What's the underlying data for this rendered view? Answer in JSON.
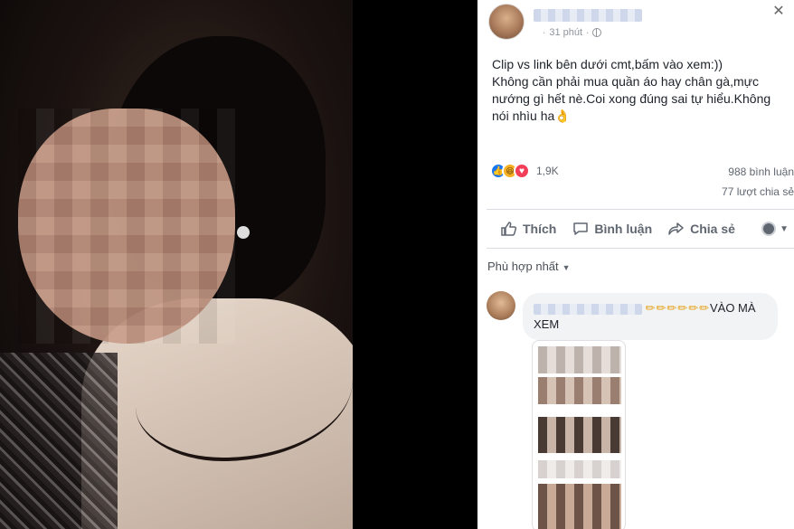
{
  "post": {
    "time": "31 phút",
    "text_lines": [
      "Clip vs link bên dưới cmt,bấm vào xem:))",
      "Không cần phải mua quần áo hay chân gà,mực nướng gì hết nè.Coi xong đúng sai tự hiểu.Không nói nhìu ha👌"
    ]
  },
  "stats": {
    "reactions_count": "1,9K",
    "comments": "988 bình luận",
    "shares": "77 lượt chia sẻ"
  },
  "actions": {
    "like": "Thích",
    "comment": "Bình luận",
    "share": "Chia sẻ"
  },
  "sort": {
    "label": "Phù hợp nhất"
  },
  "comment": {
    "emoji_row": "✏✏✏✏✏✏",
    "text": "VÀO MÀ XEM"
  },
  "icons": {
    "close": "close-icon",
    "privacy": "globe-icon",
    "like": "thumbs-up-icon",
    "comment": "speech-bubble-icon",
    "share": "share-arrow-icon"
  },
  "colors": {
    "like_blue": "#1877f2",
    "love_red": "#f33e58",
    "haha_yellow": "#f7b125",
    "text_gray": "#606770"
  }
}
